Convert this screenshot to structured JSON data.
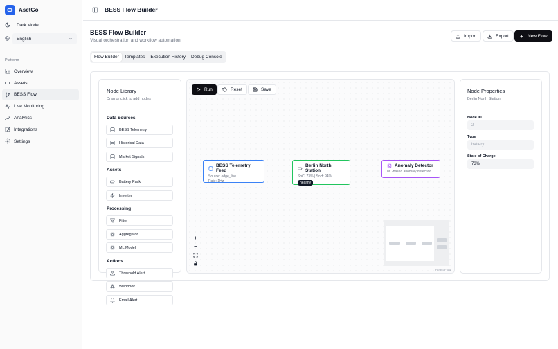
{
  "app": {
    "name": "AsetGo"
  },
  "sidebar": {
    "dark_mode_label": "Dark Mode",
    "language": "English",
    "section_label": "Platform",
    "items": [
      {
        "label": "Overview",
        "icon": "bar-chart-icon"
      },
      {
        "label": "Assets",
        "icon": "battery-icon"
      },
      {
        "label": "BESS Flow",
        "icon": "git-branch-icon"
      },
      {
        "label": "Live Monitoring",
        "icon": "activity-icon"
      },
      {
        "label": "Analytics",
        "icon": "trending-up-icon"
      },
      {
        "label": "Integrations",
        "icon": "puzzle-icon"
      },
      {
        "label": "Settings",
        "icon": "gear-icon"
      }
    ],
    "active_item": "BESS Flow"
  },
  "topbar": {
    "title": "BESS Flow Builder"
  },
  "header": {
    "title": "BESS Flow Builder",
    "subtitle": "Visual orchestration and workflow automation",
    "import_label": "Import",
    "export_label": "Export",
    "new_flow_label": "New Flow"
  },
  "tabs": [
    {
      "label": "Flow Builder",
      "active": true
    },
    {
      "label": "Templates"
    },
    {
      "label": "Execution History"
    },
    {
      "label": "Debug Console"
    }
  ],
  "library": {
    "title": "Node Library",
    "subtitle": "Drag or click to add nodes",
    "categories": [
      {
        "name": "Data Sources",
        "items": [
          "BESS Telemetry",
          "Historical Data",
          "Market Signals"
        ]
      },
      {
        "name": "Assets",
        "items": [
          "Battery Pack",
          "Inverter"
        ]
      },
      {
        "name": "Processing",
        "items": [
          "Filter",
          "Aggregator",
          "ML Model"
        ]
      },
      {
        "name": "Actions",
        "items": [
          "Threshold Alert",
          "Webhook",
          "Email Alert"
        ]
      }
    ]
  },
  "canvas": {
    "run_label": "Run",
    "reset_label": "Reset",
    "save_label": "Save",
    "nodes": [
      {
        "title": "BESS Telemetry Feed",
        "line1": "Source: edge_live",
        "line2": "Rate: 1Hz",
        "color": "#3b82f6"
      },
      {
        "title": "Berlin North Station",
        "line1": "SoC: 73% | SoH: 94%",
        "badge": "healthy",
        "color": "#22c55e"
      },
      {
        "title": "Anomaly Detector",
        "line1": "ML-based anomaly detection",
        "color": "#a855f7"
      }
    ],
    "attribution": "React Flow"
  },
  "properties": {
    "title": "Node Properties",
    "subtitle": "Berlin North Station",
    "fields": [
      {
        "label": "Node ID",
        "value": "2"
      },
      {
        "label": "Type",
        "value": "battery"
      },
      {
        "label": "State of Charge",
        "value": "73%"
      }
    ]
  },
  "colors": {
    "brand": "#2563eb",
    "primary_button": "#0f0f14"
  }
}
